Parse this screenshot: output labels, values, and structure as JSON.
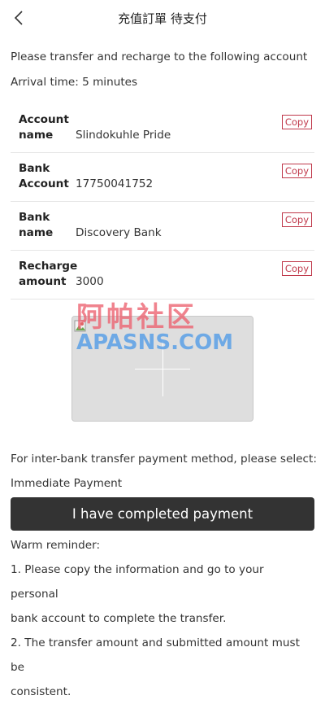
{
  "header": {
    "title": "充值訂單 待支付",
    "back_icon": "chevron-left-icon"
  },
  "intro": {
    "instruction": "Please transfer and recharge to the following account",
    "arrival": "Arrival time: 5 minutes"
  },
  "details": [
    {
      "label": "Account name",
      "value": "Slindokuhle Pride",
      "copy": "Copy"
    },
    {
      "label": "Bank Account",
      "value": "17750041752",
      "copy": "Copy"
    },
    {
      "label": "Bank name",
      "value": "Discovery Bank",
      "copy": "Copy"
    },
    {
      "label": "Recharge amount",
      "value": "3000",
      "copy": "Copy"
    }
  ],
  "watermark": {
    "chinese": "阿帕社区",
    "english": "APASNS.COM"
  },
  "payment_method": {
    "prompt": "For inter-bank transfer payment method, please select:",
    "selected": "Immediate Payment"
  },
  "submit_label": "I have completed payment",
  "reminder": {
    "title": "Warm reminder:",
    "line1a": "1. Please copy the information and go to your personal",
    "line1b": "bank account to complete the transfer.",
    "line2a": "2. The transfer amount and submitted amount must be",
    "line2b": "consistent."
  },
  "colors": {
    "copy_accent": "#c0394b",
    "button_bg": "#333333"
  }
}
